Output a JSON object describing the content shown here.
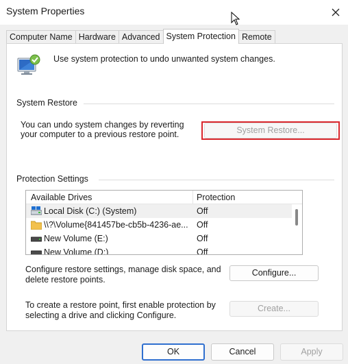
{
  "window": {
    "title": "System Properties"
  },
  "tabs": [
    {
      "label": "Computer Name"
    },
    {
      "label": "Hardware"
    },
    {
      "label": "Advanced"
    },
    {
      "label": "System Protection",
      "active": true
    },
    {
      "label": "Remote"
    }
  ],
  "intro": {
    "text": "Use system protection to undo unwanted system changes."
  },
  "system_restore": {
    "group_label": "System Restore",
    "description_line1": "You can undo system changes by reverting",
    "description_line2": "your computer to a previous restore point.",
    "button_label": "System Restore...",
    "button_enabled": false
  },
  "protection": {
    "group_label": "Protection Settings",
    "columns": [
      "Available Drives",
      "Protection"
    ],
    "drives": [
      {
        "name": "Local Disk (C:) (System)",
        "protection": "Off",
        "icon": "system-drive-icon"
      },
      {
        "name": "\\\\?\\Volume{841457be-cb5b-4236-ae...",
        "protection": "Off",
        "icon": "folder-icon"
      },
      {
        "name": "New Volume (E:)",
        "protection": "Off",
        "icon": "drive-icon"
      },
      {
        "name": "New Volume (D:)",
        "protection": "Off",
        "icon": "drive-icon"
      }
    ],
    "configure_text_line1": "Configure restore settings, manage disk space, and",
    "configure_text_line2": "delete restore points.",
    "configure_button": "Configure...",
    "create_text_line1": "To create a restore point, first enable protection by",
    "create_text_line2": "selecting a drive and clicking Configure.",
    "create_button": "Create..."
  },
  "footer": {
    "ok": "OK",
    "cancel": "Cancel",
    "apply": "Apply"
  },
  "colors": {
    "highlight": "#d9252b",
    "default_button_border": "#2f6fcf"
  }
}
